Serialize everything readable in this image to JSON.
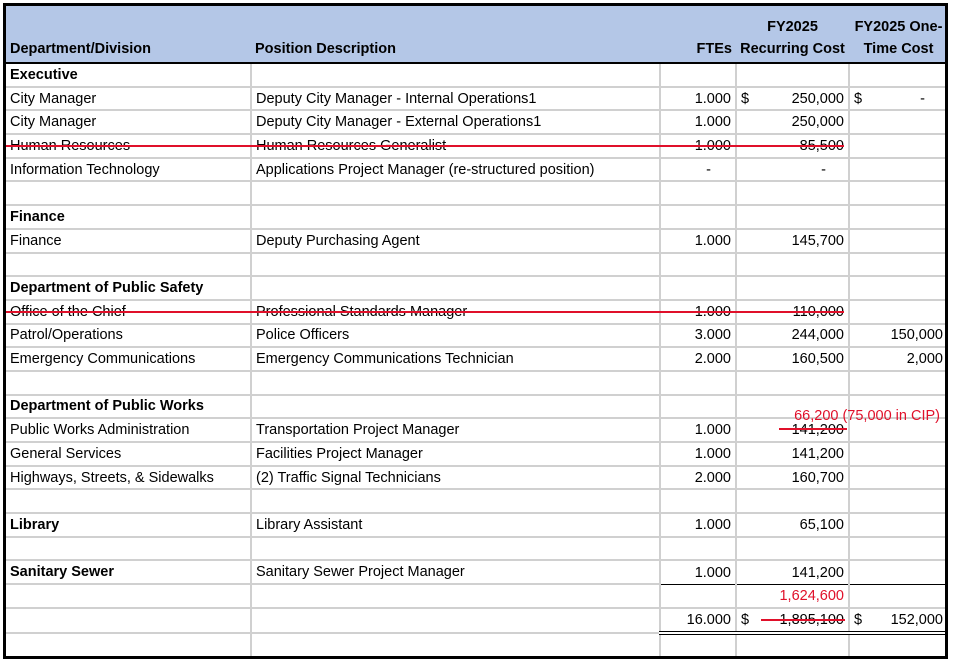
{
  "headers": {
    "department": "Department/Division",
    "position": "Position Description",
    "ftes": "FTEs",
    "recurring_line1": "FY2025",
    "recurring_line2": "Recurring Cost",
    "onetime_line1": "FY2025 One-",
    "onetime_line2": "Time Cost"
  },
  "rows": [
    {
      "type": "section",
      "dept": "Executive",
      "pos": "",
      "fte": "",
      "rec": "",
      "one": ""
    },
    {
      "type": "item",
      "dept": "City Manager",
      "pos": "Deputy City Manager - Internal Operations1",
      "fte": "1.000",
      "rec_dollar": "$",
      "rec": "250,000",
      "one_dollar": "$",
      "one": "-"
    },
    {
      "type": "item",
      "dept": "City Manager",
      "pos": "Deputy City Manager - External Operations1",
      "fte": "1.000",
      "rec": "250,000",
      "one": ""
    },
    {
      "type": "struck",
      "dept": "Human Resources",
      "pos": "Human Resources Generalist",
      "fte": "1.000",
      "rec": "85,500",
      "one": ""
    },
    {
      "type": "item",
      "dept": "Information Technology",
      "pos": "Applications Project Manager (re-structured position)",
      "fte": "-",
      "rec": "-",
      "one": ""
    },
    {
      "type": "blank"
    },
    {
      "type": "section",
      "dept": "Finance",
      "pos": "",
      "fte": "",
      "rec": "",
      "one": ""
    },
    {
      "type": "item",
      "dept": "Finance",
      "pos": "Deputy Purchasing Agent",
      "fte": "1.000",
      "rec": "145,700",
      "one": ""
    },
    {
      "type": "blank"
    },
    {
      "type": "section",
      "dept": "Department of Public Safety",
      "pos": "",
      "fte": "",
      "rec": "",
      "one": ""
    },
    {
      "type": "struck",
      "dept": "Office of the Chief",
      "pos": "Professional Standards Manager",
      "fte": "1.000",
      "rec": "110,000",
      "one": ""
    },
    {
      "type": "item",
      "dept": "Patrol/Operations",
      "pos": "Police Officers",
      "fte": "3.000",
      "rec": "244,000",
      "one": "150,000"
    },
    {
      "type": "item",
      "dept": "Emergency Communications",
      "pos": "Emergency Communications Technician",
      "fte": "2.000",
      "rec": "160,500",
      "one": "2,000"
    },
    {
      "type": "blank"
    },
    {
      "type": "section",
      "dept": "Department of Public Works",
      "pos": "",
      "fte": "",
      "rec": "",
      "one": ""
    },
    {
      "type": "revised",
      "dept": "Public Works Administration",
      "pos": "Transportation Project Manager",
      "fte": "1.000",
      "rec": "141,200",
      "revised_note": "66,200 (75,000 in CIP)",
      "one": ""
    },
    {
      "type": "item",
      "dept": "General Services",
      "pos": "Facilities Project Manager",
      "fte": "1.000",
      "rec": "141,200",
      "one": ""
    },
    {
      "type": "item",
      "dept": "Highways, Streets, & Sidewalks",
      "pos": "(2) Traffic Signal Technicians",
      "fte": "2.000",
      "rec": "160,700",
      "one": ""
    },
    {
      "type": "blank"
    },
    {
      "type": "section_item",
      "dept": "Library",
      "pos": "Library Assistant",
      "fte": "1.000",
      "rec": "65,100",
      "one": ""
    },
    {
      "type": "blank"
    },
    {
      "type": "section_item",
      "dept": "Sanitary Sewer",
      "pos": "Sanitary Sewer Project Manager",
      "fte": "1.000",
      "rec": "141,200",
      "one": ""
    }
  ],
  "totals": {
    "revised_recurring_total": "1,624,600",
    "fte_total": "16.000",
    "recurring_dollar": "$",
    "original_recurring_total": "1,895,100",
    "onetime_dollar": "$",
    "onetime_total": "152,000"
  },
  "colors": {
    "header_bg": "#b4c7e7",
    "revision_red": "#e0102a",
    "gridline": "#d0d0d0"
  }
}
